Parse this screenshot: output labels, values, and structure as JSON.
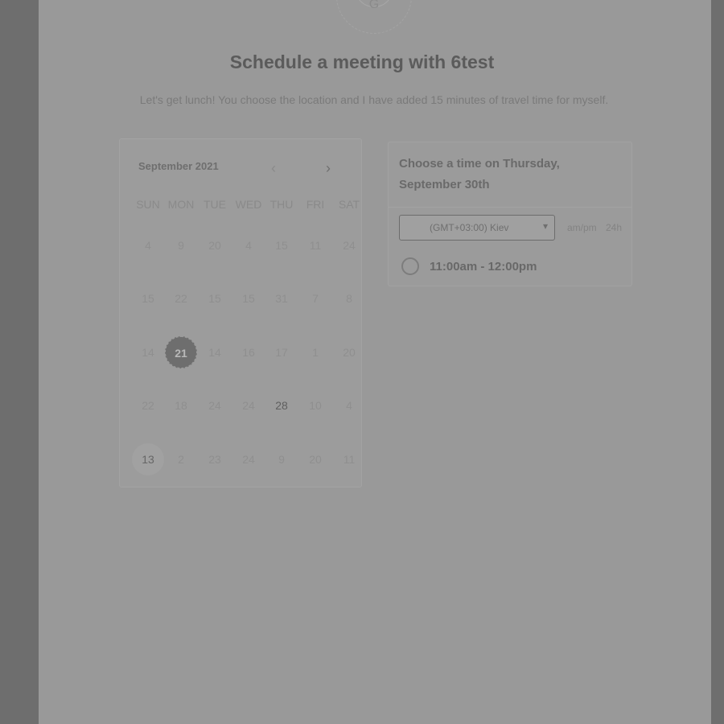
{
  "header": {
    "avatar_glyph": "G",
    "title": "Schedule a meeting with 6test",
    "subtitle": "Let's get lunch! You choose the location and I have added 15 minutes of travel time for myself."
  },
  "calendar": {
    "month_label": "September 2021",
    "prev_icon": "chevron-left-icon",
    "next_icon": "chevron-right-icon",
    "weekdays": [
      "SUN",
      "MON",
      "TUE",
      "WED",
      "THU",
      "FRI",
      "SAT"
    ],
    "weeks": [
      [
        "4",
        "9",
        "20",
        "4",
        "15",
        "11",
        "24"
      ],
      [
        "15",
        "22",
        "15",
        "15",
        "31",
        "7",
        "8"
      ],
      [
        "14",
        "21",
        "14",
        "16",
        "17",
        "1",
        "20"
      ],
      [
        "22",
        "18",
        "24",
        "24",
        "28",
        "10",
        "4"
      ],
      [
        "13",
        "2",
        "23",
        "24",
        "9",
        "20",
        "11"
      ]
    ],
    "selected_day": "21",
    "today_day": "13",
    "available_days": [
      "28"
    ]
  },
  "time_panel": {
    "header": "Choose a time on Thursday, September 30th",
    "timezone": "(GMT+03:00) Kiev",
    "format_ampm": "am/pm",
    "format_24h": "24h",
    "slots": [
      {
        "label": "11:00am - 12:00pm"
      }
    ]
  },
  "colors": {
    "overlay_background": "#6e6e6e",
    "page_background": "#999999",
    "selected_day": "#6e6e6e"
  }
}
